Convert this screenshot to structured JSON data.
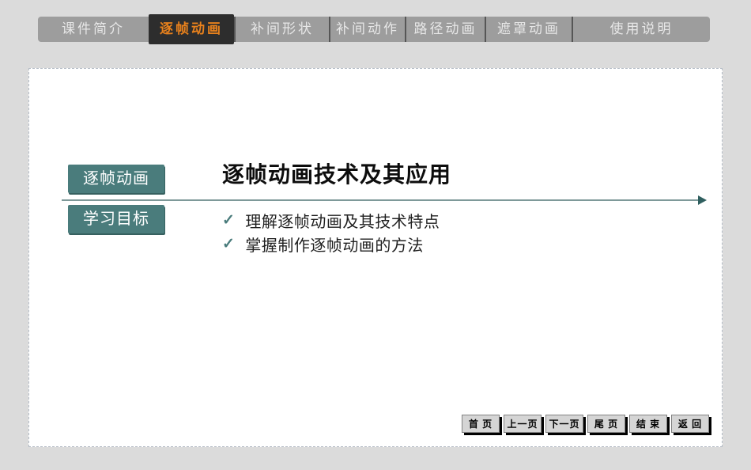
{
  "tabs": {
    "active_index": 1,
    "items": [
      {
        "label": "课件简介"
      },
      {
        "label": "逐帧动画"
      },
      {
        "label": "补间形状"
      },
      {
        "label": "补间动作"
      },
      {
        "label": "路径动画"
      },
      {
        "label": "遮罩动画"
      },
      {
        "label": "使用说明"
      }
    ]
  },
  "content": {
    "section_label": "逐帧动画",
    "title": "逐帧动画技术及其应用",
    "objectives_label": "学习目标",
    "check_glyph": "✓",
    "objectives": [
      "理解逐帧动画及其技术特点",
      "掌握制作逐帧动画的方法"
    ]
  },
  "nav": {
    "buttons": [
      "首 页",
      "上一页",
      "下一页",
      "尾 页",
      "结 束",
      "返 回"
    ]
  },
  "colors": {
    "page_background": "#dbdbdb",
    "tab_bar_background": "#9d9d9d",
    "tab_text": "#e7e7e7",
    "active_tab_background": "#2d2d2d",
    "active_tab_text": "#e8811c",
    "accent_teal": "#4a7c7c",
    "divider_line": "#7e9999",
    "arrow": "#2f5f5f",
    "panel_background": "#ffffff",
    "button_shadow": "#000000"
  }
}
